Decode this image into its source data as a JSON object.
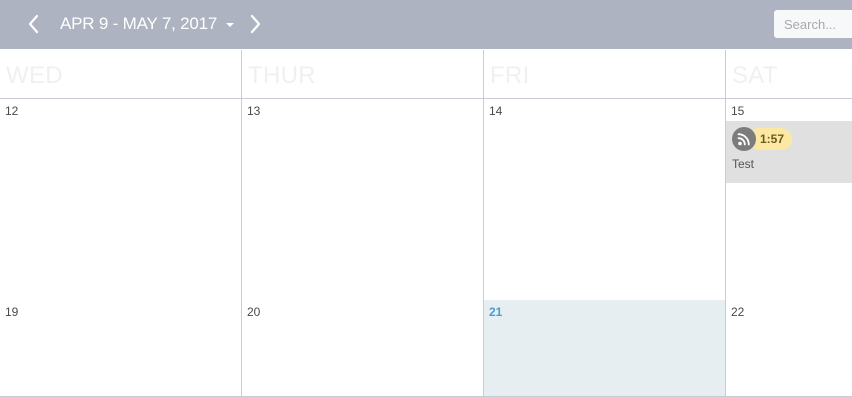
{
  "toolbar": {
    "date_range": "APR 9 - MAY 7, 2017",
    "search_placeholder": "Search..."
  },
  "weekdays": [
    "WED",
    "THUR",
    "FRI",
    "SAT"
  ],
  "weeks": [
    {
      "days": [
        "12",
        "13",
        "14",
        "15"
      ]
    },
    {
      "days": [
        "19",
        "20",
        "21",
        "22"
      ]
    }
  ],
  "today": "21",
  "events": [
    {
      "day": "15",
      "duration": "1:57",
      "title": "Test",
      "icon": "rss-feed-icon"
    }
  ],
  "colors": {
    "topbar": "#adb3c0",
    "today_bg": "#e6eef2",
    "today_num": "#4b9cd3",
    "event_bg": "#e0e0e0",
    "duration_badge": "#fbe9a3"
  }
}
